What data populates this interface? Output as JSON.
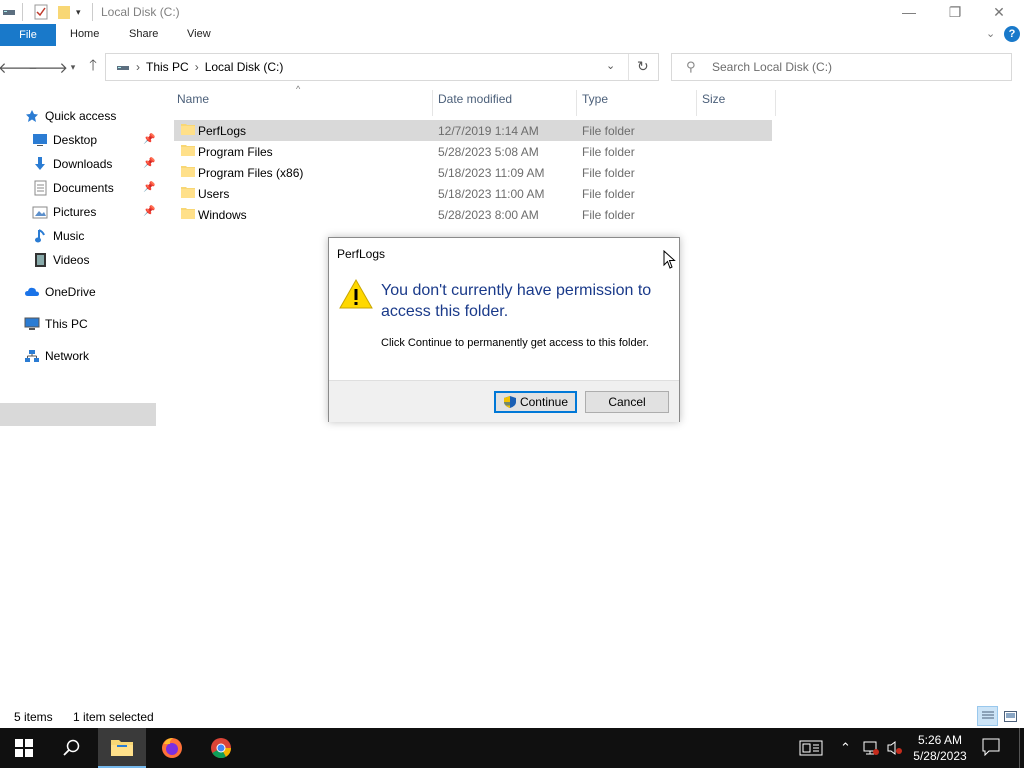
{
  "window": {
    "title": "Local Disk (C:)",
    "controls": {
      "minimize": "—",
      "maximize": "❐",
      "close": "✕"
    }
  },
  "ribbon": {
    "tabs": [
      {
        "label": "File"
      },
      {
        "label": "Home"
      },
      {
        "label": "Share"
      },
      {
        "label": "View"
      }
    ]
  },
  "address": {
    "crumbs": [
      "This PC",
      "Local Disk (C:)"
    ],
    "search_placeholder": "Search Local Disk (C:)"
  },
  "navpane": {
    "items": [
      {
        "label": "Quick access",
        "icon": "star-icon"
      },
      {
        "label": "Desktop",
        "icon": "desktop-icon",
        "pinned": true
      },
      {
        "label": "Downloads",
        "icon": "download-icon",
        "pinned": true
      },
      {
        "label": "Documents",
        "icon": "documents-icon",
        "pinned": true
      },
      {
        "label": "Pictures",
        "icon": "pictures-icon",
        "pinned": true
      },
      {
        "label": "Music",
        "icon": "music-icon"
      },
      {
        "label": "Videos",
        "icon": "videos-icon"
      },
      {
        "label": "OneDrive",
        "icon": "cloud-icon"
      },
      {
        "label": "This PC",
        "icon": "computer-icon",
        "selected": true
      },
      {
        "label": "Network",
        "icon": "network-icon"
      }
    ]
  },
  "columns": {
    "name": "Name",
    "date": "Date modified",
    "type": "Type",
    "size": "Size"
  },
  "files": [
    {
      "name": "PerfLogs",
      "date": "12/7/2019 1:14 AM",
      "type": "File folder",
      "selected": true
    },
    {
      "name": "Program Files",
      "date": "5/28/2023 5:08 AM",
      "type": "File folder"
    },
    {
      "name": "Program Files (x86)",
      "date": "5/18/2023 11:09 AM",
      "type": "File folder"
    },
    {
      "name": "Users",
      "date": "5/18/2023 11:00 AM",
      "type": "File folder"
    },
    {
      "name": "Windows",
      "date": "5/28/2023 8:00 AM",
      "type": "File folder"
    }
  ],
  "dialog": {
    "title": "PerfLogs",
    "message": "You don't currently have permission to access this folder.",
    "sub": "Click Continue to permanently get access to this folder.",
    "continue_label": "Continue",
    "cancel_label": "Cancel"
  },
  "statusbar": {
    "count": "5 items",
    "selected": "1 item selected"
  },
  "taskbar": {
    "time": "5:26 AM",
    "date": "5/28/2023"
  },
  "colors": {
    "accent": "#1979ca",
    "selection": "#d9d9d9",
    "dialog_text": "#1a3a8a",
    "taskbar": "#101010"
  }
}
